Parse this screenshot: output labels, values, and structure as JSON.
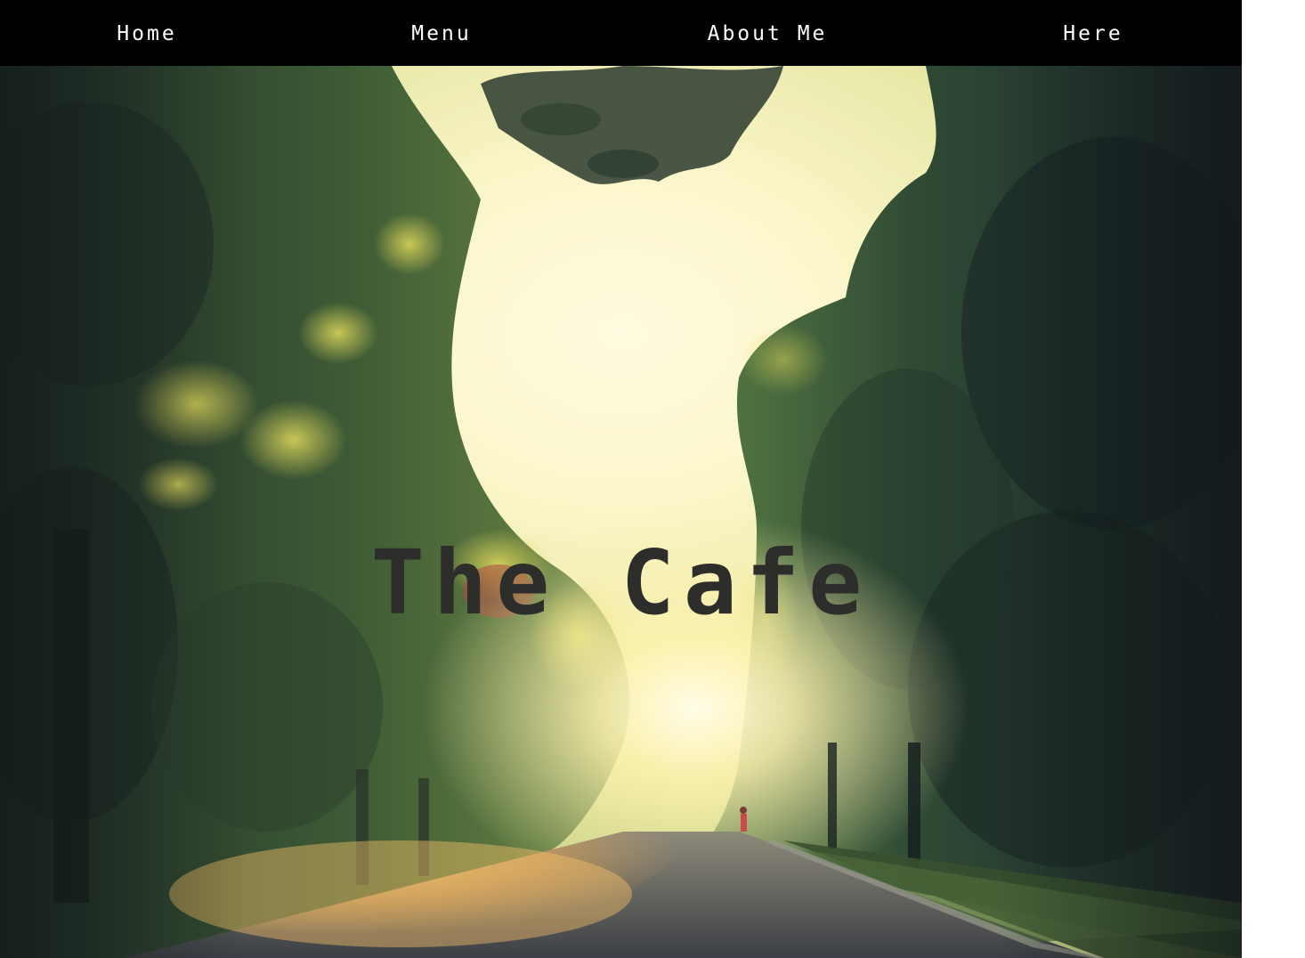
{
  "nav": {
    "items": [
      {
        "label": "Home"
      },
      {
        "label": "Menu"
      },
      {
        "label": "About Me"
      },
      {
        "label": "Here"
      }
    ]
  },
  "hero": {
    "title": "The Cafe",
    "image": "sunlit-tree-lined-street-photo"
  },
  "colors": {
    "nav_background": "#000000",
    "nav_text": "#ffffff",
    "title_text": "#2d2d2b"
  }
}
